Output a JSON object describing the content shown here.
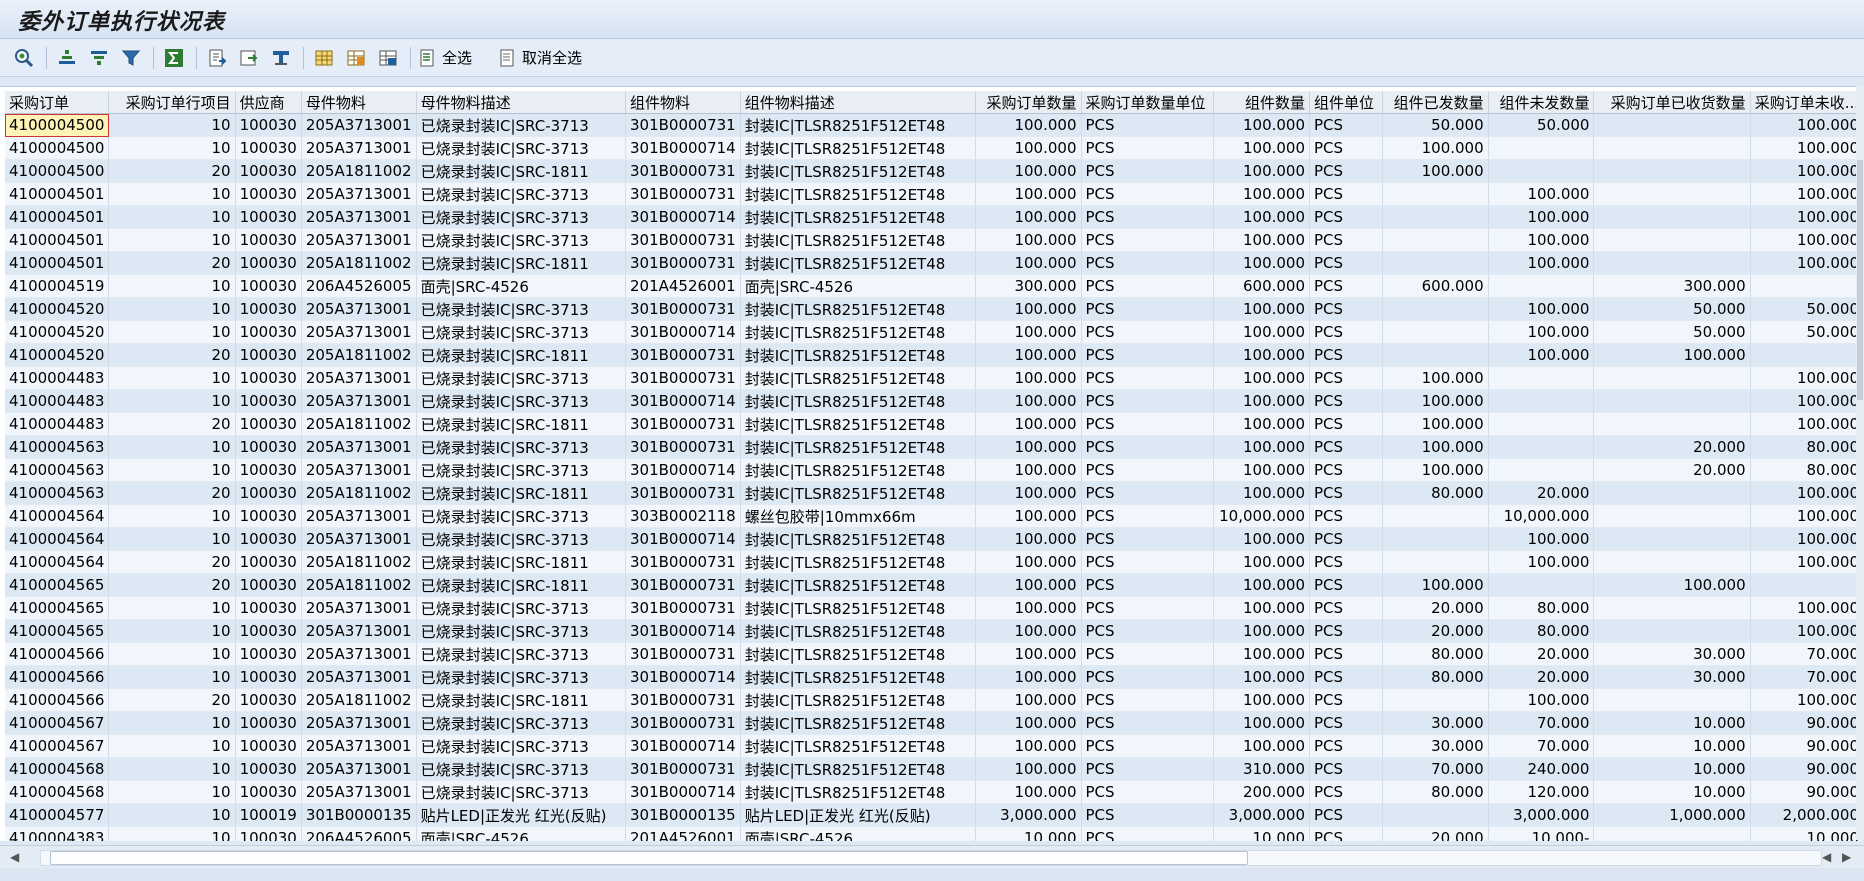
{
  "window": {
    "title": "委外订单执行状况表"
  },
  "toolbar": {
    "select_all_label": "全选",
    "deselect_all_label": "取消全选",
    "icons": [
      "details-icon",
      "sort-ascending-icon",
      "sort-descending-icon",
      "filter-icon",
      "sum-icon",
      "export-icon",
      "print-preview-icon",
      "subtotal-icon",
      "layout-icon",
      "change-layout-icon",
      "select-layout-icon",
      "select-all-icon",
      "deselect-all-icon"
    ]
  },
  "columns": [
    {
      "label": "采购订单",
      "align": "left"
    },
    {
      "label": "采购订单行项目",
      "align": "right"
    },
    {
      "label": "供应商",
      "align": "left"
    },
    {
      "label": "母件物料",
      "align": "left"
    },
    {
      "label": "母件物料描述",
      "align": "left"
    },
    {
      "label": "组件物料",
      "align": "left"
    },
    {
      "label": "组件物料描述",
      "align": "left"
    },
    {
      "label": "采购订单数量",
      "align": "right"
    },
    {
      "label": "采购订单数量单位",
      "align": "left"
    },
    {
      "label": "组件数量",
      "align": "right"
    },
    {
      "label": "组件单位",
      "align": "left"
    },
    {
      "label": "组件已发数量",
      "align": "right"
    },
    {
      "label": "组件未发数量",
      "align": "right"
    },
    {
      "label": "采购订单已收货数量",
      "align": "right"
    },
    {
      "label": "采购订单未收...",
      "align": "right"
    }
  ],
  "rows": [
    [
      "4100004500",
      "10",
      "100030",
      "205A3713001",
      "已烧录封装IC|SRC-3713",
      "301B0000731",
      "封装IC|TLSR8251F512ET48",
      "100.000",
      "PCS",
      "100.000",
      "PCS",
      "50.000",
      "50.000",
      "",
      "100.000"
    ],
    [
      "4100004500",
      "10",
      "100030",
      "205A3713001",
      "已烧录封装IC|SRC-3713",
      "301B0000714",
      "封装IC|TLSR8251F512ET48",
      "100.000",
      "PCS",
      "100.000",
      "PCS",
      "100.000",
      "",
      "",
      "100.000"
    ],
    [
      "4100004500",
      "20",
      "100030",
      "205A1811002",
      "已烧录封装IC|SRC-1811",
      "301B0000731",
      "封装IC|TLSR8251F512ET48",
      "100.000",
      "PCS",
      "100.000",
      "PCS",
      "100.000",
      "",
      "",
      "100.000"
    ],
    [
      "4100004501",
      "10",
      "100030",
      "205A3713001",
      "已烧录封装IC|SRC-3713",
      "301B0000731",
      "封装IC|TLSR8251F512ET48",
      "100.000",
      "PCS",
      "100.000",
      "PCS",
      "",
      "100.000",
      "",
      "100.000"
    ],
    [
      "4100004501",
      "10",
      "100030",
      "205A3713001",
      "已烧录封装IC|SRC-3713",
      "301B0000714",
      "封装IC|TLSR8251F512ET48",
      "100.000",
      "PCS",
      "100.000",
      "PCS",
      "",
      "100.000",
      "",
      "100.000"
    ],
    [
      "4100004501",
      "10",
      "100030",
      "205A3713001",
      "已烧录封装IC|SRC-3713",
      "301B0000731",
      "封装IC|TLSR8251F512ET48",
      "100.000",
      "PCS",
      "100.000",
      "PCS",
      "",
      "100.000",
      "",
      "100.000"
    ],
    [
      "4100004501",
      "20",
      "100030",
      "205A1811002",
      "已烧录封装IC|SRC-1811",
      "301B0000731",
      "封装IC|TLSR8251F512ET48",
      "100.000",
      "PCS",
      "100.000",
      "PCS",
      "",
      "100.000",
      "",
      "100.000"
    ],
    [
      "4100004519",
      "10",
      "100030",
      "206A4526005",
      "面壳|SRC-4526",
      "201A4526001",
      "面壳|SRC-4526",
      "300.000",
      "PCS",
      "600.000",
      "PCS",
      "600.000",
      "",
      "300.000",
      ""
    ],
    [
      "4100004520",
      "10",
      "100030",
      "205A3713001",
      "已烧录封装IC|SRC-3713",
      "301B0000731",
      "封装IC|TLSR8251F512ET48",
      "100.000",
      "PCS",
      "100.000",
      "PCS",
      "",
      "100.000",
      "50.000",
      "50.000"
    ],
    [
      "4100004520",
      "10",
      "100030",
      "205A3713001",
      "已烧录封装IC|SRC-3713",
      "301B0000714",
      "封装IC|TLSR8251F512ET48",
      "100.000",
      "PCS",
      "100.000",
      "PCS",
      "",
      "100.000",
      "50.000",
      "50.000"
    ],
    [
      "4100004520",
      "20",
      "100030",
      "205A1811002",
      "已烧录封装IC|SRC-1811",
      "301B0000731",
      "封装IC|TLSR8251F512ET48",
      "100.000",
      "PCS",
      "100.000",
      "PCS",
      "",
      "100.000",
      "100.000",
      ""
    ],
    [
      "4100004483",
      "10",
      "100030",
      "205A3713001",
      "已烧录封装IC|SRC-3713",
      "301B0000731",
      "封装IC|TLSR8251F512ET48",
      "100.000",
      "PCS",
      "100.000",
      "PCS",
      "100.000",
      "",
      "",
      "100.000"
    ],
    [
      "4100004483",
      "10",
      "100030",
      "205A3713001",
      "已烧录封装IC|SRC-3713",
      "301B0000714",
      "封装IC|TLSR8251F512ET48",
      "100.000",
      "PCS",
      "100.000",
      "PCS",
      "100.000",
      "",
      "",
      "100.000"
    ],
    [
      "4100004483",
      "20",
      "100030",
      "205A1811002",
      "已烧录封装IC|SRC-1811",
      "301B0000731",
      "封装IC|TLSR8251F512ET48",
      "100.000",
      "PCS",
      "100.000",
      "PCS",
      "100.000",
      "",
      "",
      "100.000"
    ],
    [
      "4100004563",
      "10",
      "100030",
      "205A3713001",
      "已烧录封装IC|SRC-3713",
      "301B0000731",
      "封装IC|TLSR8251F512ET48",
      "100.000",
      "PCS",
      "100.000",
      "PCS",
      "100.000",
      "",
      "20.000",
      "80.000"
    ],
    [
      "4100004563",
      "10",
      "100030",
      "205A3713001",
      "已烧录封装IC|SRC-3713",
      "301B0000714",
      "封装IC|TLSR8251F512ET48",
      "100.000",
      "PCS",
      "100.000",
      "PCS",
      "100.000",
      "",
      "20.000",
      "80.000"
    ],
    [
      "4100004563",
      "20",
      "100030",
      "205A1811002",
      "已烧录封装IC|SRC-1811",
      "301B0000731",
      "封装IC|TLSR8251F512ET48",
      "100.000",
      "PCS",
      "100.000",
      "PCS",
      "80.000",
      "20.000",
      "",
      "100.000"
    ],
    [
      "4100004564",
      "10",
      "100030",
      "205A3713001",
      "已烧录封装IC|SRC-3713",
      "303B0002118",
      "螺丝包胶带|10mmx66m",
      "100.000",
      "PCS",
      "10,000.000",
      "PCS",
      "",
      "10,000.000",
      "",
      "100.000"
    ],
    [
      "4100004564",
      "10",
      "100030",
      "205A3713001",
      "已烧录封装IC|SRC-3713",
      "301B0000714",
      "封装IC|TLSR8251F512ET48",
      "100.000",
      "PCS",
      "100.000",
      "PCS",
      "",
      "100.000",
      "",
      "100.000"
    ],
    [
      "4100004564",
      "20",
      "100030",
      "205A1811002",
      "已烧录封装IC|SRC-1811",
      "301B0000731",
      "封装IC|TLSR8251F512ET48",
      "100.000",
      "PCS",
      "100.000",
      "PCS",
      "",
      "100.000",
      "",
      "100.000"
    ],
    [
      "4100004565",
      "20",
      "100030",
      "205A1811002",
      "已烧录封装IC|SRC-1811",
      "301B0000731",
      "封装IC|TLSR8251F512ET48",
      "100.000",
      "PCS",
      "100.000",
      "PCS",
      "100.000",
      "",
      "100.000",
      ""
    ],
    [
      "4100004565",
      "10",
      "100030",
      "205A3713001",
      "已烧录封装IC|SRC-3713",
      "301B0000731",
      "封装IC|TLSR8251F512ET48",
      "100.000",
      "PCS",
      "100.000",
      "PCS",
      "20.000",
      "80.000",
      "",
      "100.000"
    ],
    [
      "4100004565",
      "10",
      "100030",
      "205A3713001",
      "已烧录封装IC|SRC-3713",
      "301B0000714",
      "封装IC|TLSR8251F512ET48",
      "100.000",
      "PCS",
      "100.000",
      "PCS",
      "20.000",
      "80.000",
      "",
      "100.000"
    ],
    [
      "4100004566",
      "10",
      "100030",
      "205A3713001",
      "已烧录封装IC|SRC-3713",
      "301B0000731",
      "封装IC|TLSR8251F512ET48",
      "100.000",
      "PCS",
      "100.000",
      "PCS",
      "80.000",
      "20.000",
      "30.000",
      "70.000"
    ],
    [
      "4100004566",
      "10",
      "100030",
      "205A3713001",
      "已烧录封装IC|SRC-3713",
      "301B0000714",
      "封装IC|TLSR8251F512ET48",
      "100.000",
      "PCS",
      "100.000",
      "PCS",
      "80.000",
      "20.000",
      "30.000",
      "70.000"
    ],
    [
      "4100004566",
      "20",
      "100030",
      "205A1811002",
      "已烧录封装IC|SRC-1811",
      "301B0000731",
      "封装IC|TLSR8251F512ET48",
      "100.000",
      "PCS",
      "100.000",
      "PCS",
      "",
      "100.000",
      "",
      "100.000"
    ],
    [
      "4100004567",
      "10",
      "100030",
      "205A3713001",
      "已烧录封装IC|SRC-3713",
      "301B0000731",
      "封装IC|TLSR8251F512ET48",
      "100.000",
      "PCS",
      "100.000",
      "PCS",
      "30.000",
      "70.000",
      "10.000",
      "90.000"
    ],
    [
      "4100004567",
      "10",
      "100030",
      "205A3713001",
      "已烧录封装IC|SRC-3713",
      "301B0000714",
      "封装IC|TLSR8251F512ET48",
      "100.000",
      "PCS",
      "100.000",
      "PCS",
      "30.000",
      "70.000",
      "10.000",
      "90.000"
    ],
    [
      "4100004568",
      "10",
      "100030",
      "205A3713001",
      "已烧录封装IC|SRC-3713",
      "301B0000731",
      "封装IC|TLSR8251F512ET48",
      "100.000",
      "PCS",
      "310.000",
      "PCS",
      "70.000",
      "240.000",
      "10.000",
      "90.000"
    ],
    [
      "4100004568",
      "10",
      "100030",
      "205A3713001",
      "已烧录封装IC|SRC-3713",
      "301B0000714",
      "封装IC|TLSR8251F512ET48",
      "100.000",
      "PCS",
      "200.000",
      "PCS",
      "80.000",
      "120.000",
      "10.000",
      "90.000"
    ],
    [
      "4100004577",
      "10",
      "100019",
      "301B0000135",
      "贴片LED|正发光 红光(反贴)",
      "301B0000135",
      "贴片LED|正发光 红光(反贴)",
      "3,000.000",
      "PCS",
      "3,000.000",
      "PCS",
      "",
      "3,000.000",
      "1,000.000",
      "2,000.000"
    ],
    [
      "4100004383",
      "10",
      "100030",
      "206A4526005",
      "面壳|SRC-4526",
      "201A4526001",
      "面壳|SRC-4526",
      "10.000",
      "PCS",
      "10.000",
      "PCS",
      "20.000",
      "10.000-",
      "",
      "10.000"
    ]
  ],
  "selected_cell": {
    "row": 0,
    "col": 0
  }
}
